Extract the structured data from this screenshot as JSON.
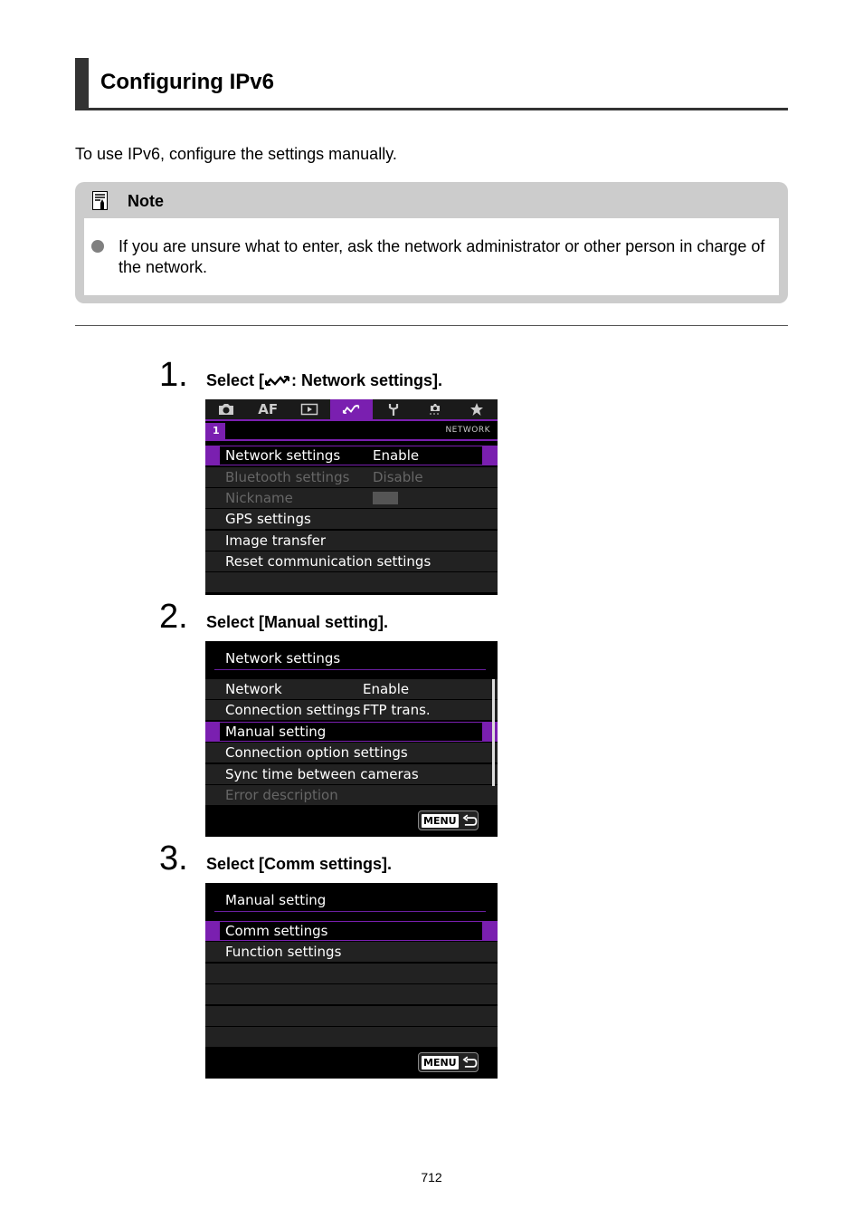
{
  "heading": {
    "title": "Configuring IPv6"
  },
  "intro": "To use IPv6, configure the settings manually.",
  "note": {
    "icon": "note-icon",
    "title": "Note",
    "items": [
      "If you are unsure what to enter, ask the network administrator or other person in charge of the network."
    ]
  },
  "steps": [
    {
      "number": "1.",
      "text_prefix": "Select [",
      "text_icon": "network-icon",
      "text_suffix": ": Network settings].",
      "screen": {
        "tabs": [
          {
            "icon": "camera-icon",
            "label": ""
          },
          {
            "icon": "af-icon",
            "label": "AF"
          },
          {
            "icon": "playback-icon",
            "label": ""
          },
          {
            "icon": "network-icon",
            "label": "",
            "active": true
          },
          {
            "icon": "wrench-icon",
            "label": ""
          },
          {
            "icon": "custom-function-icon",
            "label": ""
          },
          {
            "icon": "star-icon",
            "label": ""
          }
        ],
        "subtab": "1",
        "section_tag": "NETWORK",
        "rows": [
          {
            "label": "Network settings",
            "value": "Enable",
            "selected": true
          },
          {
            "label": "Bluetooth settings",
            "value": "Disable",
            "dim": true
          },
          {
            "label": "Nickname",
            "value": "",
            "dim": true
          },
          {
            "label": "GPS settings",
            "value": ""
          },
          {
            "label": "Image transfer",
            "value": ""
          },
          {
            "label": "Reset communication settings",
            "value": ""
          }
        ]
      }
    },
    {
      "number": "2.",
      "text": "Select [Manual setting].",
      "screen": {
        "title": "Network settings",
        "rows": [
          {
            "label": "Network",
            "value": "Enable"
          },
          {
            "label": "Connection settings",
            "value": "FTP trans."
          },
          {
            "label": "Manual setting",
            "value": "",
            "selected": true
          },
          {
            "label": "Connection option settings",
            "value": ""
          },
          {
            "label": "Sync time between cameras",
            "value": ""
          },
          {
            "label": "Error description",
            "value": "",
            "dim": true
          }
        ],
        "menu_button": "MENU"
      }
    },
    {
      "number": "3.",
      "text": "Select [Comm settings].",
      "screen": {
        "title": "Manual setting",
        "rows": [
          {
            "label": "Comm settings",
            "value": "",
            "selected": true
          },
          {
            "label": "Function settings",
            "value": ""
          }
        ],
        "menu_button": "MENU"
      }
    }
  ],
  "page_number": "712"
}
